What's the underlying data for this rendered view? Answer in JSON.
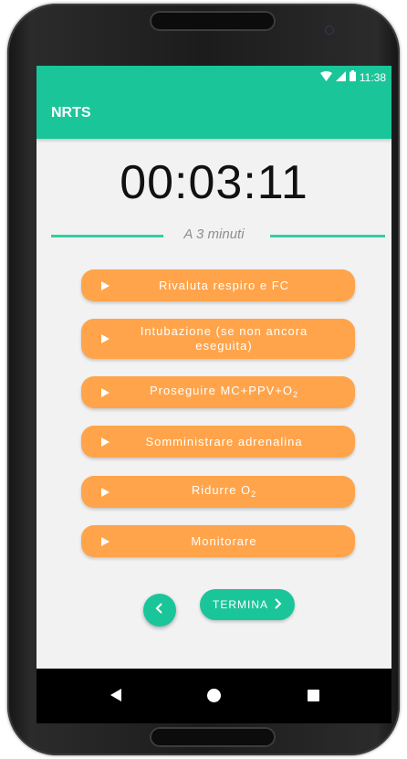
{
  "status_bar": {
    "time": "11:38",
    "icons": [
      "wifi-icon",
      "signal-icon",
      "battery-icon"
    ]
  },
  "app_bar": {
    "title": "NRTS"
  },
  "timer": {
    "value": "00:03:11"
  },
  "section": {
    "label": "A 3 minuti"
  },
  "actions": [
    {
      "label": "Rivaluta respiro e FC"
    },
    {
      "label": "Intubazione (se non ancora eseguita)"
    },
    {
      "label": "Proseguire MC+PPV+O",
      "subscript": "2"
    },
    {
      "label": "Somministrare adrenalina"
    },
    {
      "label": "Ridurre O",
      "subscript": "2"
    },
    {
      "label": "Monitorare"
    }
  ],
  "footer": {
    "back_icon": "chevron-left-icon",
    "terminate_label": "TERMINA",
    "terminate_icon": "chevron-right-icon"
  },
  "nav_bar": {
    "icons": [
      "back-icon",
      "home-icon",
      "recents-icon"
    ]
  },
  "colors": {
    "primary": "#1bc59a",
    "accent": "#ffa44a",
    "background": "#f2f2f2",
    "divider": "#2fd09f"
  }
}
